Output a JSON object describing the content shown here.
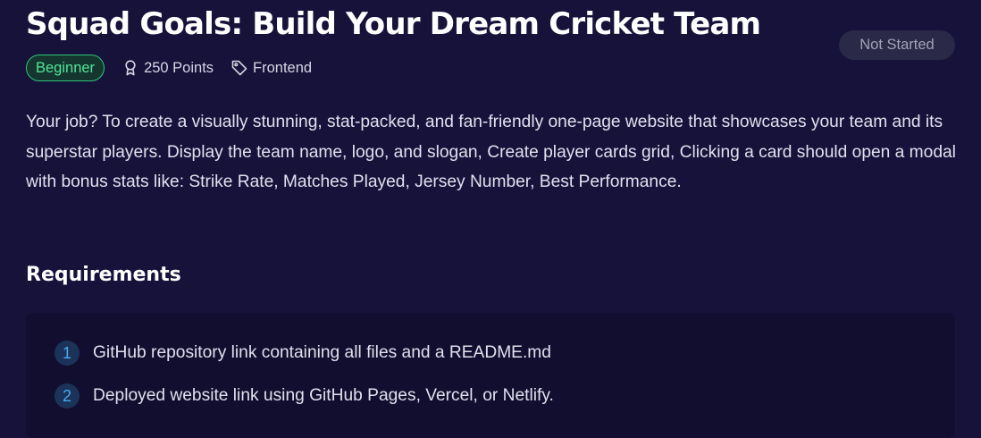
{
  "challenge": {
    "title": "Squad Goals: Build Your Dream Cricket Team",
    "status": "Not Started",
    "level": "Beginner",
    "points": "250 Points",
    "category": "Frontend",
    "description": "Your job? To create a visually stunning, stat-packed, and fan-friendly one-page website that showcases your team and its superstar players. Display the team name, logo, and slogan, Create player cards grid, Clicking a card should open a modal with bonus stats like: Strike Rate, Matches Played, Jersey Number, Best Performance."
  },
  "requirements": {
    "heading": "Requirements",
    "items": [
      {
        "number": "1",
        "text": "GitHub repository link containing all files and a README.md"
      },
      {
        "number": "2",
        "text": "Deployed website link using GitHub Pages, Vercel, or Netlify."
      }
    ]
  },
  "icons": {
    "points": "award-icon",
    "category": "tag-icon"
  },
  "colors": {
    "background": "#16123a",
    "panel": "#110e2f",
    "level_green": "#52e495",
    "status_badge": "#2a2947",
    "number_blue": "#48a7f0"
  }
}
